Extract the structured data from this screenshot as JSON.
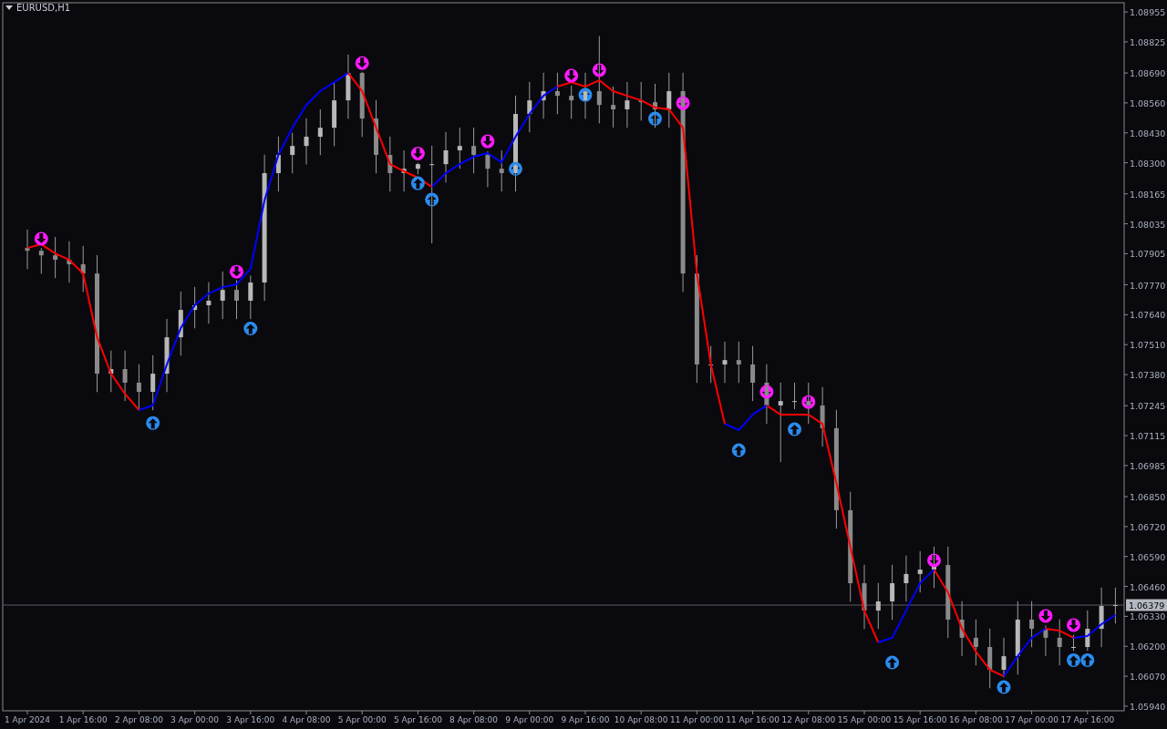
{
  "window": {
    "title": "EURUSD,H1"
  },
  "chart": {
    "chart_data": {
      "type": "candlestick",
      "ylim": [
        1.0592,
        1.08995
      ],
      "ref_lines": [
        {
          "axis": "y",
          "value": 1.06379,
          "label": "1.06379"
        }
      ],
      "categories": [
        "1 Apr 2024",
        null,
        null,
        null,
        "1 Apr 16:00",
        null,
        null,
        null,
        "2 Apr 08:00",
        null,
        null,
        null,
        "3 Apr 00:00",
        null,
        null,
        null,
        "3 Apr 16:00",
        null,
        null,
        null,
        "4 Apr 08:00",
        null,
        null,
        null,
        "5 Apr 00:00",
        null,
        null,
        null,
        "5 Apr 16:00",
        null,
        null,
        null,
        "8 Apr 08:00",
        null,
        null,
        null,
        "9 Apr 00:00",
        null,
        null,
        null,
        "9 Apr 16:00",
        null,
        null,
        null,
        "10 Apr 08:00",
        null,
        null,
        null,
        "11 Apr 00:00",
        null,
        null,
        null,
        "11 Apr 16:00",
        null,
        null,
        null,
        "12 Apr 08:00",
        null,
        null,
        null,
        "15 Apr 00:00",
        null,
        null,
        null,
        "15 Apr 16:00",
        null,
        null,
        null,
        "16 Apr 08:00",
        null,
        null,
        null,
        "17 Apr 00:00",
        null,
        null,
        null,
        "17 Apr 16:00",
        null,
        null
      ],
      "ohlc": [
        [
          1.0793,
          1.0801,
          1.07838,
          1.07918
        ],
        [
          1.07918,
          1.0793,
          1.07818,
          1.07898
        ],
        [
          1.07898,
          1.07978,
          1.07799,
          1.07879
        ],
        [
          1.07879,
          1.07959,
          1.07779,
          1.07859
        ],
        [
          1.07859,
          1.07939,
          1.07739,
          1.07819
        ],
        [
          1.07819,
          1.07899,
          1.07304,
          1.07384
        ],
        [
          1.07384,
          1.07484,
          1.07304,
          1.07404
        ],
        [
          1.07404,
          1.07484,
          1.07265,
          1.07345
        ],
        [
          1.07345,
          1.07425,
          1.07225,
          1.07305
        ],
        [
          1.07305,
          1.07464,
          1.07225,
          1.07384
        ],
        [
          1.07384,
          1.07622,
          1.07304,
          1.07542
        ],
        [
          1.07542,
          1.07741,
          1.07462,
          1.07661
        ],
        [
          1.07661,
          1.07761,
          1.07581,
          1.07681
        ],
        [
          1.07681,
          1.07781,
          1.07601,
          1.07701
        ],
        [
          1.07701,
          1.07828,
          1.07621,
          1.07748
        ],
        [
          1.07748,
          1.0779,
          1.07621,
          1.07701
        ],
        [
          1.07701,
          1.0781,
          1.07621,
          1.0778
        ],
        [
          1.0778,
          1.08335,
          1.077,
          1.08255
        ],
        [
          1.08255,
          1.08414,
          1.08175,
          1.08334
        ],
        [
          1.08334,
          1.0843,
          1.08254,
          1.08373
        ],
        [
          1.08373,
          1.08493,
          1.08293,
          1.08413
        ],
        [
          1.08413,
          1.08532,
          1.08333,
          1.08452
        ],
        [
          1.08452,
          1.08651,
          1.08372,
          1.08571
        ],
        [
          1.08571,
          1.0877,
          1.08491,
          1.0869
        ],
        [
          1.0869,
          1.08695,
          1.08412,
          1.08492
        ],
        [
          1.08492,
          1.08572,
          1.08254,
          1.08334
        ],
        [
          1.08334,
          1.08414,
          1.08175,
          1.08255
        ],
        [
          1.08255,
          1.08354,
          1.08175,
          1.08274
        ],
        [
          1.08274,
          1.083,
          1.0825,
          1.08294
        ],
        [
          1.08294,
          1.08374,
          1.0795,
          1.08294
        ],
        [
          1.08294,
          1.08434,
          1.08214,
          1.08354
        ],
        [
          1.08354,
          1.08453,
          1.08274,
          1.08373
        ],
        [
          1.08373,
          1.08453,
          1.08254,
          1.08334
        ],
        [
          1.08334,
          1.0835,
          1.08194,
          1.08274
        ],
        [
          1.08274,
          1.08354,
          1.08175,
          1.08255
        ],
        [
          1.08255,
          1.08592,
          1.08175,
          1.08512
        ],
        [
          1.08512,
          1.08651,
          1.08432,
          1.08571
        ],
        [
          1.08571,
          1.08691,
          1.08491,
          1.08611
        ],
        [
          1.08611,
          1.08691,
          1.08511,
          1.08591
        ],
        [
          1.08591,
          1.08635,
          1.08491,
          1.08571
        ],
        [
          1.08571,
          1.08691,
          1.08491,
          1.08611
        ],
        [
          1.08611,
          1.0885,
          1.08471,
          1.08551
        ],
        [
          1.08551,
          1.08631,
          1.08452,
          1.08532
        ],
        [
          1.08532,
          1.08651,
          1.08452,
          1.08571
        ],
        [
          1.08571,
          1.08651,
          1.08483,
          1.08563
        ],
        [
          1.08563,
          1.08643,
          1.08452,
          1.08532
        ],
        [
          1.08532,
          1.08691,
          1.08452,
          1.08611
        ],
        [
          1.08611,
          1.08691,
          1.07739,
          1.07819
        ],
        [
          1.07819,
          1.07899,
          1.07344,
          1.07424
        ],
        [
          1.07424,
          1.07504,
          1.07344,
          1.07424
        ],
        [
          1.07424,
          1.07523,
          1.07344,
          1.07443
        ],
        [
          1.07443,
          1.07523,
          1.07344,
          1.07424
        ],
        [
          1.07424,
          1.07504,
          1.07265,
          1.07345
        ],
        [
          1.07345,
          1.07425,
          1.07166,
          1.07246
        ],
        [
          1.07246,
          1.07345,
          1.07,
          1.07265
        ],
        [
          1.07265,
          1.07345,
          1.0723,
          1.07265
        ],
        [
          1.07265,
          1.07345,
          1.07166,
          1.07246
        ],
        [
          1.07246,
          1.07326,
          1.07067,
          1.07147
        ],
        [
          1.07147,
          1.07227,
          1.06711,
          1.06791
        ],
        [
          1.06791,
          1.06871,
          1.06394,
          1.06474
        ],
        [
          1.06474,
          1.06554,
          1.06275,
          1.06355
        ],
        [
          1.06355,
          1.06475,
          1.06275,
          1.06395
        ],
        [
          1.06395,
          1.06554,
          1.06315,
          1.06474
        ],
        [
          1.06474,
          1.06594,
          1.06394,
          1.06514
        ],
        [
          1.06514,
          1.06613,
          1.06434,
          1.06533
        ],
        [
          1.06533,
          1.06633,
          1.06453,
          1.06553
        ],
        [
          1.06553,
          1.06633,
          1.06236,
          1.06316
        ],
        [
          1.06316,
          1.06396,
          1.06157,
          1.06237
        ],
        [
          1.06237,
          1.06317,
          1.06117,
          1.06197
        ],
        [
          1.06197,
          1.06277,
          1.06018,
          1.06098
        ],
        [
          1.06098,
          1.06237,
          1.06065,
          1.06157
        ],
        [
          1.06157,
          1.06396,
          1.06077,
          1.06316
        ],
        [
          1.06316,
          1.06396,
          1.06196,
          1.06276
        ],
        [
          1.06276,
          1.0629,
          1.06157,
          1.06237
        ],
        [
          1.06237,
          1.06317,
          1.06117,
          1.06197
        ],
        [
          1.06197,
          1.0625,
          1.0618,
          1.06197
        ],
        [
          1.06197,
          1.06356,
          1.0618,
          1.06276
        ],
        [
          1.06276,
          1.06455,
          1.06196,
          1.06375
        ],
        [
          1.06375,
          1.06455,
          1.06299,
          1.06379
        ]
      ],
      "series": [
        {
          "type": "line",
          "color": "#ff0000",
          "values": [
            1.0793,
            1.07946,
            1.07906,
            1.07879,
            1.07819,
            1.07542,
            1.07384,
            1.07297,
            1.07226,
            null,
            null,
            null,
            null,
            null,
            null,
            null,
            null,
            null,
            null,
            null,
            null,
            null,
            null,
            1.0869,
            1.08611,
            1.08452,
            1.08294,
            1.08263,
            1.08235,
            1.08195,
            null,
            null,
            null,
            null,
            null,
            null,
            null,
            null,
            1.08631,
            1.0865,
            1.08631,
            1.08658,
            1.08611,
            1.08591,
            1.08571,
            1.0854,
            1.08532,
            1.08452,
            1.07819,
            1.07424,
            1.07166,
            null,
            null,
            1.07246,
            1.07206,
            1.07206,
            1.07206,
            1.07166,
            1.06909,
            1.06632,
            1.06355,
            1.06217,
            null,
            null,
            null,
            1.06533,
            1.06434,
            1.06276,
            1.06177,
            1.06098,
            1.0607,
            null,
            null,
            1.06276,
            1.06268,
            1.06237,
            null,
            null,
            null
          ]
        },
        {
          "type": "line",
          "color": "#0000ff",
          "values": [
            null,
            null,
            null,
            null,
            null,
            null,
            null,
            null,
            1.07226,
            1.07246,
            1.07424,
            1.07582,
            1.07681,
            1.07732,
            1.0776,
            1.07772,
            1.07839,
            1.08136,
            1.08334,
            1.08452,
            1.08551,
            1.08611,
            1.0865,
            1.0869,
            null,
            null,
            null,
            null,
            null,
            1.08195,
            1.08255,
            1.08294,
            1.08326,
            1.08342,
            1.08302,
            1.08413,
            1.08512,
            1.08591,
            1.08631,
            null,
            null,
            null,
            null,
            null,
            null,
            null,
            null,
            null,
            null,
            null,
            1.07166,
            1.07139,
            1.07206,
            1.07246,
            null,
            null,
            null,
            null,
            null,
            null,
            null,
            1.06217,
            1.06237,
            1.06355,
            1.06474,
            1.06533,
            null,
            null,
            null,
            null,
            1.0607,
            1.06157,
            1.06237,
            1.06276,
            null,
            1.06237,
            1.06245,
            1.06296,
            1.06336
          ]
        },
        {
          "type": "scatter",
          "color": "#ff1aff",
          "values": [
            null,
            1.0797,
            null,
            null,
            null,
            null,
            null,
            null,
            null,
            null,
            null,
            null,
            null,
            null,
            null,
            1.07827,
            null,
            null,
            null,
            null,
            null,
            null,
            null,
            null,
            1.08733,
            null,
            null,
            null,
            1.0834,
            null,
            null,
            null,
            null,
            1.08393,
            null,
            null,
            null,
            null,
            null,
            1.08678,
            null,
            1.08702,
            null,
            null,
            null,
            null,
            null,
            1.08559,
            null,
            null,
            null,
            null,
            null,
            1.07305,
            null,
            null,
            1.07261,
            null,
            null,
            null,
            null,
            null,
            null,
            null,
            null,
            1.06573,
            null,
            null,
            null,
            null,
            null,
            null,
            null,
            1.06332,
            null,
            1.06292,
            null,
            null,
            null
          ]
        },
        {
          "type": "scatter",
          "color": "#2a8cf0",
          "values": [
            null,
            null,
            null,
            null,
            null,
            null,
            null,
            null,
            null,
            1.0717,
            null,
            null,
            null,
            null,
            null,
            null,
            1.0758,
            null,
            null,
            null,
            null,
            null,
            null,
            null,
            null,
            null,
            null,
            null,
            1.08211,
            1.0814,
            null,
            null,
            null,
            null,
            null,
            1.08274,
            null,
            null,
            null,
            null,
            1.08595,
            null,
            null,
            null,
            null,
            1.08492,
            null,
            null,
            null,
            null,
            null,
            1.07052,
            null,
            null,
            null,
            1.07143,
            null,
            null,
            null,
            null,
            null,
            null,
            1.0613,
            null,
            null,
            null,
            null,
            null,
            null,
            null,
            1.06023,
            null,
            null,
            null,
            null,
            1.0614,
            1.0614,
            null,
            null
          ]
        }
      ],
      "yticks": [
        {
          "value": 1.08955,
          "label": "1.08955"
        },
        {
          "value": 1.08825,
          "label": "1.08825"
        },
        {
          "value": 1.0869,
          "label": "1.08690"
        },
        {
          "value": 1.0856,
          "label": "1.08560"
        },
        {
          "value": 1.0843,
          "label": "1.08430"
        },
        {
          "value": 1.083,
          "label": "1.08300"
        },
        {
          "value": 1.08165,
          "label": "1.08165"
        },
        {
          "value": 1.08035,
          "label": "1.08035"
        },
        {
          "value": 1.07905,
          "label": "1.07905"
        },
        {
          "value": 1.0777,
          "label": "1.07770"
        },
        {
          "value": 1.0764,
          "label": "1.07640"
        },
        {
          "value": 1.0751,
          "label": "1.07510"
        },
        {
          "value": 1.0738,
          "label": "1.07380"
        },
        {
          "value": 1.07245,
          "label": "1.07245"
        },
        {
          "value": 1.07115,
          "label": "1.07115"
        },
        {
          "value": 1.06985,
          "label": "1.06985"
        },
        {
          "value": 1.0685,
          "label": "1.06850"
        },
        {
          "value": 1.0672,
          "label": "1.06720"
        },
        {
          "value": 1.0659,
          "label": "1.06590"
        },
        {
          "value": 1.0646,
          "label": "1.06460"
        },
        {
          "value": 1.0633,
          "label": "1.06330"
        },
        {
          "value": 1.062,
          "label": "1.06200"
        },
        {
          "value": 1.0607,
          "label": "1.06070"
        },
        {
          "value": 1.0594,
          "label": "1.05940"
        }
      ]
    }
  }
}
